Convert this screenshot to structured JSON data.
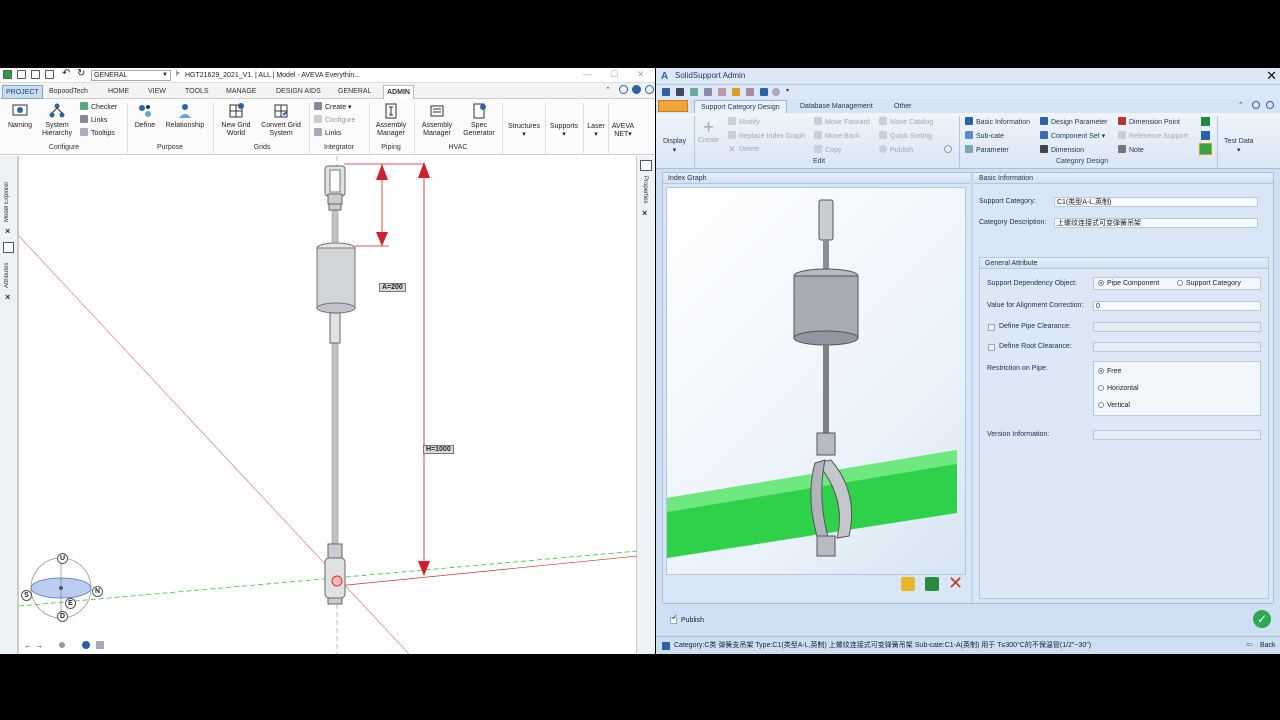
{
  "aveva": {
    "workspace": "GENERAL",
    "document_title": "HGT21629_2021_V1. | ALL | Model - AVEVA Everythin...",
    "tabs": [
      "PROJECT",
      "BopoodTech",
      "HOME",
      "VIEW",
      "TOOLS",
      "MANAGE",
      "DESIGN AIDS",
      "GENERAL",
      "ADMIN"
    ],
    "ribbon": {
      "naming": "Naming",
      "system_hierarchy": "System\nHierarchy",
      "checker": "Checker",
      "links": "Links",
      "tooltips": "Tooltips",
      "configure_group": "Configure",
      "define": "Define",
      "relationship": "Relationship",
      "purpose_group": "Purpose",
      "new_grid_world": "New Grid\nWorld",
      "convert_grid_system": "Convert Grid\nSystem",
      "grids_group": "Grids",
      "create": "Create",
      "configure": "Configure",
      "int_links": "Links",
      "integrator_group": "Integrator",
      "assembly_manager_piping": "Assembly\nManager",
      "piping_group": "Piping",
      "assembly_manager_hvac": "Assembly\nManager",
      "spec_generator": "Spec\nGenerator",
      "hvac_group": "HVAC",
      "structures": "Structures",
      "supports": "Supports",
      "laser": "Laser",
      "aveva_net": "AVEVA\nNET"
    },
    "side_left": [
      "Model Explorer",
      "Attributes"
    ],
    "side_right": [
      "Properties"
    ],
    "dimensions": {
      "a": "A=200",
      "h": "H=1000"
    },
    "compass": {
      "u": "U",
      "d": "D",
      "s": "S",
      "n": "N",
      "e": "E"
    }
  },
  "solidsupport": {
    "title": "SolidSupport Admin",
    "tabs": [
      "Support Category Design",
      "Database Management",
      "Other"
    ],
    "ribbon": {
      "display": "Display",
      "create": "Create",
      "modify": "Modify",
      "replace_index_graph": "Replace Index Graph",
      "delete": "Delete",
      "move_forward": "Move Forward",
      "move_back": "Move Back",
      "copy": "Copy",
      "move_catalog": "Move Catalog",
      "quick_sorting": "Quick Sorting",
      "publish": "Publish",
      "edit_group": "Edit",
      "basic_information": "Basic Information",
      "sub_cate": "Sub-cate",
      "parameter": "Parameter",
      "design_parameter": "Design Parameter",
      "component_set": "Component Set",
      "dimension": "Dimension",
      "dimension_point": "Dimension Point",
      "reference_support": "Reference Support",
      "note": "Note",
      "category_design_group": "Category Design",
      "test_data": "Test Data"
    },
    "index_graph_title": "Index Graph",
    "basic_info": {
      "header": "Basic Information",
      "support_category_label": "Support Category:",
      "support_category_value": "C1(类型A-L,英制)",
      "category_description_label": "Category Description:",
      "category_description_value": "上螺纹连接式可变弹簧吊架"
    },
    "general_attribute": {
      "header": "General Attribute",
      "dependency_label": "Support Dependency Object:",
      "dep_pipe_component": "Pipe Component",
      "dep_support_category": "Support Category",
      "alignment_label": "Value for Alignment Correction:",
      "alignment_value": "0",
      "pipe_clearance_label": "Define Pipe Clearance:",
      "root_clearance_label": "Define Root Clearance:",
      "restriction_label": "Restriction on Pipe:",
      "restriction_free": "Free",
      "restriction_horizontal": "Horizontal",
      "restriction_vertical": "Vertical",
      "version_label": "Version Information:"
    },
    "publish_label": "Publish",
    "status_text": "Category:C类 弹簧支吊架   Type:C1(类型A-L,英制) 上螺纹连接式可变弹簧吊架   Sub-cate:C1-A(英制) 用于 T≤300°C的不保温管(1/2\"~30\")",
    "back_label": "Back"
  },
  "colors": {
    "pipe": "#2fd14a",
    "dim_red": "#d0202c",
    "accent": "#2b63a8"
  }
}
